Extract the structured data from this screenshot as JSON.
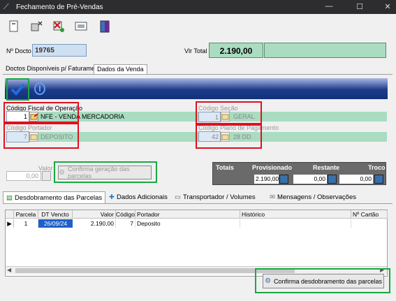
{
  "window": {
    "title": "Fechamento de Pré-Vendas",
    "minimize": "—",
    "maximize": "☐",
    "close": "✕"
  },
  "header": {
    "doc_label": "Nº Docto",
    "doc_value": "19765",
    "total_label": "Vlr Total",
    "total_value": "2.190,00"
  },
  "tabs": [
    {
      "label": "Doctos Disponíveis p/ Faturamento"
    },
    {
      "label": "Dados da Venda"
    }
  ],
  "fields": {
    "fiscal_label": "Código Fiscal de Operação",
    "fiscal_code": "1",
    "fiscal_desc": "NFE - VENDA MERCADORIA",
    "secao_label": "Código Seção",
    "secao_code": "1",
    "secao_desc": "GERAL",
    "portador_label": "Código Portador",
    "portador_code": "7",
    "portador_desc": "DEPOSITO",
    "plano_label": "Código Plano de Pagamento",
    "plano_code": "42",
    "plano_desc": "28 DD",
    "valor_label": "Valor",
    "valor_value": "0,00"
  },
  "confirm_parcelas_btn": "Confirma geração das parcelas",
  "totals": {
    "headers": [
      "Totais",
      "Provisionado",
      "Restante",
      "Troco"
    ],
    "provisionado": "2.190,00",
    "restante": "0,00",
    "troco": "0,00"
  },
  "lower_tabs": [
    {
      "label": "Desdobramento das Parcelas"
    },
    {
      "label": "Dados Adicionais"
    },
    {
      "label": "Transportador / Volumes"
    },
    {
      "label": "Mensagens / Observações"
    }
  ],
  "grid": {
    "columns": [
      "Parcela",
      "DT Vencto",
      "Valor",
      "Código",
      "Portador",
      "Histórico",
      "Nº Cartão"
    ],
    "rows": [
      {
        "parcela": "1",
        "vencto": "26/09/24",
        "valor": "2.190,00",
        "codigo": "7",
        "portador": "Deposito",
        "historico": "",
        "cartao": ""
      }
    ]
  },
  "confirm_desdobramento_btn": "Confirma desdobramento das parcelas",
  "colors": {
    "accent_green": "#a9dcc0",
    "highlight_red": "#e01020",
    "highlight_green": "#1aa844"
  }
}
